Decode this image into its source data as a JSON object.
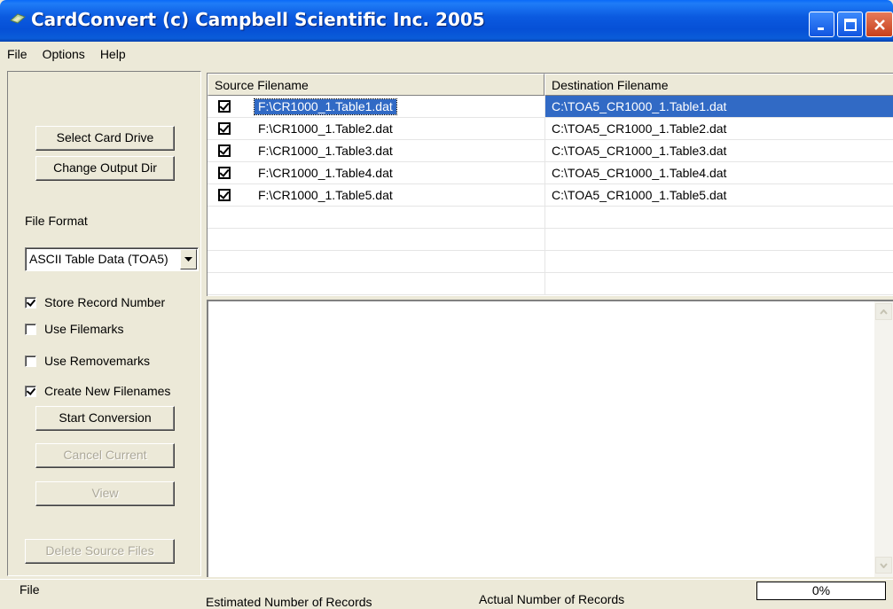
{
  "window": {
    "title": "CardConvert  (c) Campbell Scientific Inc. 2005",
    "title_bar_color": "#0650d6"
  },
  "menu": [
    "File",
    "Options",
    "Help"
  ],
  "left_panel": {
    "select_card_drive": "Select Card Drive",
    "change_output_dir": "Change Output Dir",
    "file_format_label": "File Format",
    "file_format_value": "ASCII Table Data (TOA5)",
    "checkboxes": [
      {
        "label": "Store Record Number",
        "checked": true
      },
      {
        "label": "Use Filemarks",
        "checked": false
      },
      {
        "label": "Use Removemarks",
        "checked": false
      },
      {
        "label": "Create New Filenames",
        "checked": true
      }
    ],
    "start_conversion": "Start Conversion",
    "cancel_current": "Cancel Current",
    "view": "View",
    "delete_source_files": "Delete Source Files"
  },
  "file_list": {
    "columns": [
      "Source Filename",
      "Destination Filename"
    ],
    "rows": [
      {
        "checked": true,
        "source": "F:\\CR1000_1.Table1.dat",
        "destination": "C:\\TOA5_CR1000_1.Table1.dat",
        "selected": true
      },
      {
        "checked": true,
        "source": "F:\\CR1000_1.Table2.dat",
        "destination": "C:\\TOA5_CR1000_1.Table2.dat",
        "selected": false
      },
      {
        "checked": true,
        "source": "F:\\CR1000_1.Table3.dat",
        "destination": "C:\\TOA5_CR1000_1.Table3.dat",
        "selected": false
      },
      {
        "checked": true,
        "source": "F:\\CR1000_1.Table4.dat",
        "destination": "C:\\TOA5_CR1000_1.Table4.dat",
        "selected": false
      },
      {
        "checked": true,
        "source": "F:\\CR1000_1.Table5.dat",
        "destination": "C:\\TOA5_CR1000_1.Table5.dat",
        "selected": false
      }
    ],
    "selection_color": "#316ac5"
  },
  "status_bar": {
    "file_label": "File",
    "estimated_label": "Estimated Number of Records",
    "actual_label": "Actual Number of Records",
    "progress_text": "0%",
    "progress_value": 0
  },
  "icons": [
    "app-icon",
    "minimize-icon",
    "maximize-icon",
    "close-icon",
    "dropdown-arrow-icon",
    "scroll-up-icon",
    "scroll-down-icon"
  ]
}
